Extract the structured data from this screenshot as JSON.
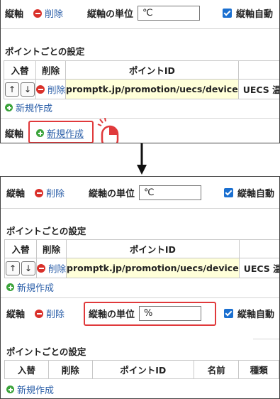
{
  "panel_top": {
    "axis_label": "縦軸",
    "delete_label": "削除",
    "unit_label": "縦軸の単位",
    "unit_value": "℃",
    "auto_label": "縦軸自動",
    "points_title": "ポイントごとの設定",
    "columns": [
      "入替",
      "削除",
      "ポイントID",
      ""
    ],
    "row": {
      "up": "↑",
      "down": "↓",
      "delete": "削除",
      "point_id": "promptk.jp/promotion/uecs/device",
      "name": "UECS 温度"
    },
    "new_point": "新規作成",
    "axis_label2": "縦軸",
    "new_axis": "新規作成"
  },
  "panel_bottom": {
    "axis1": {
      "axis_label": "縦軸",
      "delete_label": "削除",
      "unit_label": "縦軸の単位",
      "unit_value": "℃",
      "auto_label": "縦軸自動"
    },
    "points_title": "ポイントごとの設定",
    "columns": [
      "入替",
      "削除",
      "ポイントID",
      ""
    ],
    "row": {
      "up": "↑",
      "down": "↓",
      "delete": "削除",
      "point_id": "promptk.jp/promotion/uecs/device",
      "name": "UECS 温度"
    },
    "new_point": "新規作成",
    "axis2": {
      "axis_label": "縦軸",
      "delete_label": "削除",
      "unit_label": "縦軸の単位",
      "unit_value": "%",
      "auto_label": "縦軸自動"
    },
    "points_title2": "ポイントごとの設定",
    "columns2": [
      "入替",
      "削除",
      "ポイントID",
      "名前",
      "種類"
    ],
    "new_point2": "新規作成"
  },
  "colors": {
    "highlight": "#e0393b",
    "link": "#2a5ea8",
    "delete_icon": "#d9302a",
    "add_icon": "#3aa33a",
    "point_id_bg": "#ffffd9"
  }
}
